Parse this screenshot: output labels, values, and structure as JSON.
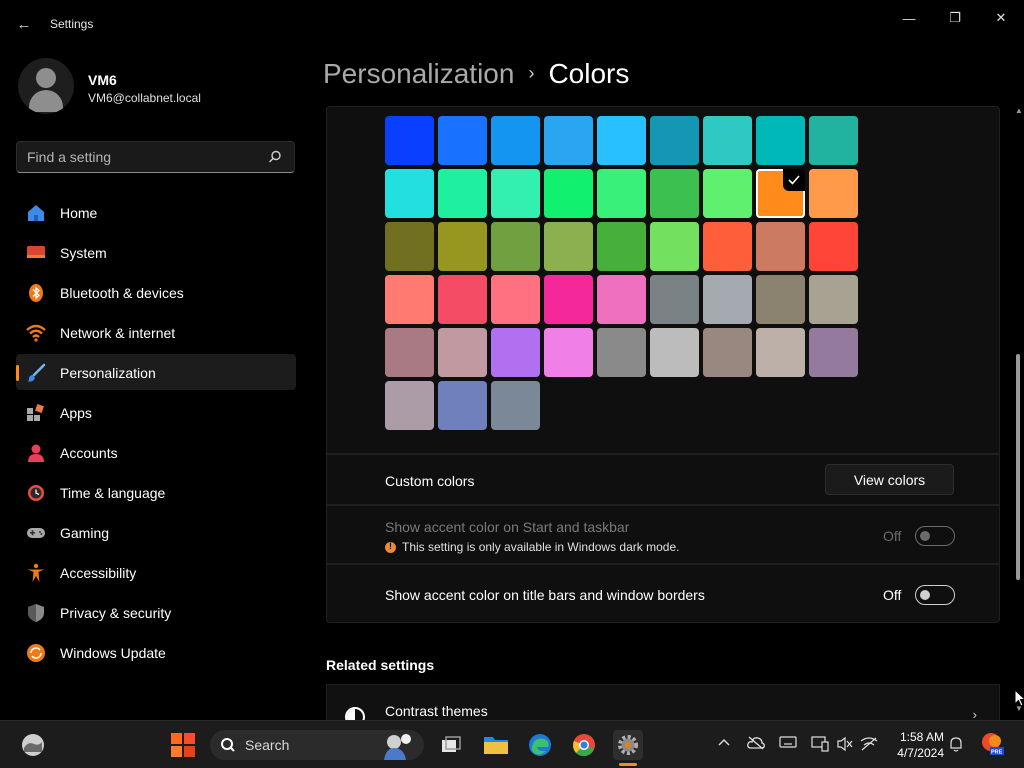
{
  "window": {
    "title": "Settings",
    "back_glyph": "←",
    "minimize_glyph": "—",
    "restore_glyph": "❐",
    "close_glyph": "✕"
  },
  "user": {
    "name": "VM6",
    "email": "VM6@collabnet.local"
  },
  "search": {
    "placeholder": "Find a setting"
  },
  "sidebar": {
    "items": [
      {
        "label": "Home",
        "icon": "home-icon"
      },
      {
        "label": "System",
        "icon": "system-icon"
      },
      {
        "label": "Bluetooth & devices",
        "icon": "bluetooth-icon"
      },
      {
        "label": "Network & internet",
        "icon": "network-icon"
      },
      {
        "label": "Personalization",
        "icon": "personalization-icon",
        "selected": true
      },
      {
        "label": "Apps",
        "icon": "apps-icon"
      },
      {
        "label": "Accounts",
        "icon": "accounts-icon"
      },
      {
        "label": "Time & language",
        "icon": "time-language-icon"
      },
      {
        "label": "Gaming",
        "icon": "gaming-icon"
      },
      {
        "label": "Accessibility",
        "icon": "accessibility-icon"
      },
      {
        "label": "Privacy & security",
        "icon": "privacy-icon"
      },
      {
        "label": "Windows Update",
        "icon": "windows-update-icon"
      }
    ]
  },
  "breadcrumb": {
    "parent": "Personalization",
    "separator": "›",
    "current": "Colors"
  },
  "accent_colors": {
    "selected_color": "#ff8c1a",
    "swatches": [
      "#0a3fff",
      "#1a73ff",
      "#1496f0",
      "#2aa5f0",
      "#28c0ff",
      "#1497b4",
      "#2ec9c2",
      "#00b8b8",
      "#22b3a0",
      "#22e0e0",
      "#1ef0a0",
      "#34f0b0",
      "#12f070",
      "#38f07a",
      "#3cc050",
      "#60f070",
      "#ff8c1a",
      "#ff9a4a",
      "#707020",
      "#969620",
      "#70a040",
      "#8cb050",
      "#46b03a",
      "#74e060",
      "#ff5e3a",
      "#cc7a62",
      "#ff4438",
      "#ff7a70",
      "#f44c64",
      "#ff7080",
      "#f42898",
      "#f070c0",
      "#7a8286",
      "#a4aab0",
      "#8c8270",
      "#a8a292",
      "#aa7a84",
      "#c09aa0",
      "#b070f0",
      "#f080e8",
      "#8a8a8a",
      "#bcbcbc",
      "#988880",
      "#bcb0a8",
      "#947a9c",
      "#ac9ca8",
      "#7080bc",
      "#7a8898"
    ]
  },
  "custom_colors": {
    "label": "Custom colors",
    "button_label": "View colors"
  },
  "accent_start_taskbar": {
    "label": "Show accent color on Start and taskbar",
    "note": "This setting is only available in Windows dark mode.",
    "state_label": "Off"
  },
  "accent_title_bars": {
    "label": "Show accent color on title bars and window borders",
    "state_label": "Off"
  },
  "related": {
    "title": "Related settings",
    "items": [
      {
        "label": "Contrast themes",
        "chevron": "›"
      }
    ]
  },
  "taskbar": {
    "search_label": "Search",
    "time": "1:58 AM",
    "date": "4/7/2024"
  }
}
